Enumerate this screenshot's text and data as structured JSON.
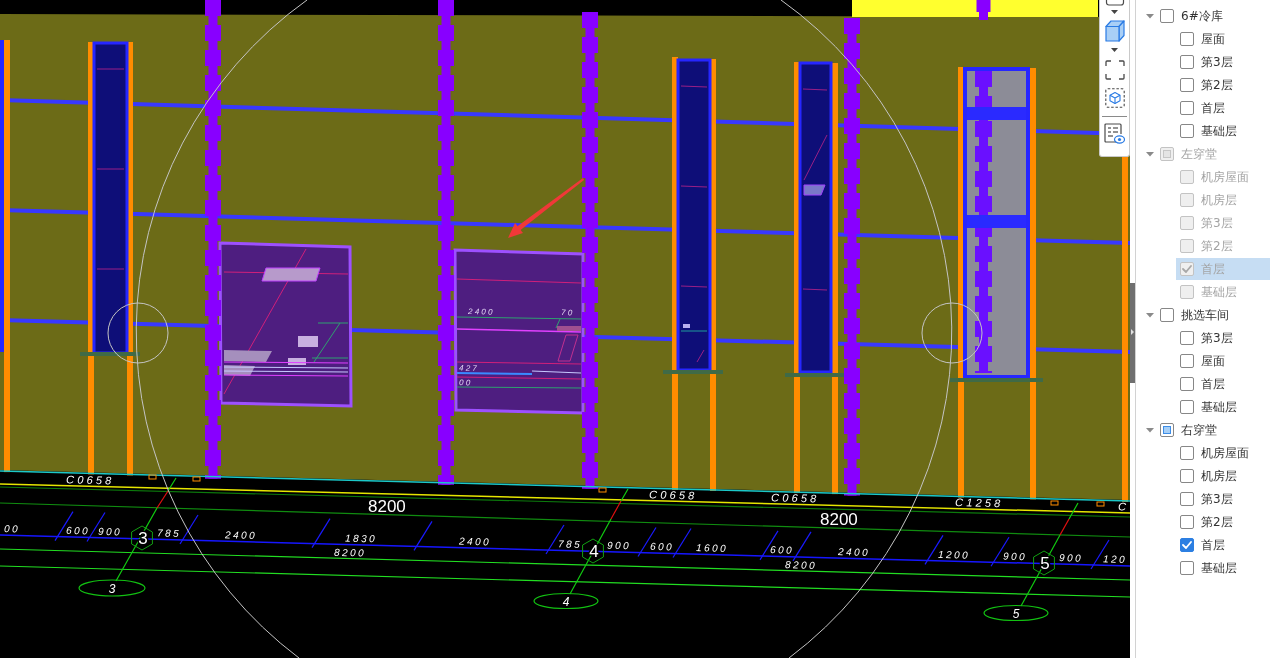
{
  "viewport": {
    "opening_tags": [
      "C0658",
      "C0658",
      "C0658",
      "C1258",
      "C"
    ],
    "bay_dimensions": [
      "8200",
      "8200"
    ],
    "segment_dimensions": [
      "00",
      "600",
      "900",
      "785",
      "2400",
      "1830",
      "2400",
      "785",
      "900",
      "600",
      "1600",
      "600",
      "2400",
      "1200",
      "900",
      "900",
      "120"
    ],
    "total_dimensions": [
      "8200",
      "8200"
    ],
    "axis_markers": [
      "3",
      "4",
      "5"
    ],
    "axis_bubbles": [
      "3",
      "4",
      "5"
    ],
    "window_annotations": [
      "2400",
      "70",
      "427",
      "00"
    ]
  },
  "tree": [
    {
      "label": "6#冷库",
      "expanded": true,
      "checked": false,
      "indeterminate": false,
      "disabled": false,
      "selected": false,
      "children": [
        {
          "label": "屋面",
          "checked": false,
          "disabled": false,
          "selected": false
        },
        {
          "label": "第3层",
          "checked": false,
          "disabled": false,
          "selected": false
        },
        {
          "label": "第2层",
          "checked": false,
          "disabled": false,
          "selected": false
        },
        {
          "label": "首层",
          "checked": false,
          "disabled": false,
          "selected": false
        },
        {
          "label": "基础层",
          "checked": false,
          "disabled": false,
          "selected": false
        }
      ]
    },
    {
      "label": "左穿堂",
      "expanded": true,
      "checked": false,
      "indeterminate": true,
      "disabled": true,
      "selected": false,
      "children": [
        {
          "label": "机房屋面",
          "checked": false,
          "disabled": true,
          "selected": false
        },
        {
          "label": "机房层",
          "checked": false,
          "disabled": true,
          "selected": false
        },
        {
          "label": "第3层",
          "checked": false,
          "disabled": true,
          "selected": false
        },
        {
          "label": "第2层",
          "checked": false,
          "disabled": true,
          "selected": false
        },
        {
          "label": "首层",
          "checked": true,
          "disabled": true,
          "selected": true
        },
        {
          "label": "基础层",
          "checked": false,
          "disabled": true,
          "selected": false
        }
      ]
    },
    {
      "label": "挑选车间",
      "expanded": true,
      "checked": false,
      "indeterminate": false,
      "disabled": false,
      "selected": false,
      "children": [
        {
          "label": "第3层",
          "checked": false,
          "disabled": false,
          "selected": false
        },
        {
          "label": "屋面",
          "checked": false,
          "disabled": false,
          "selected": false
        },
        {
          "label": "首层",
          "checked": false,
          "disabled": false,
          "selected": false
        },
        {
          "label": "基础层",
          "checked": false,
          "disabled": false,
          "selected": false
        }
      ]
    },
    {
      "label": "右穿堂",
      "expanded": true,
      "checked": false,
      "indeterminate": true,
      "disabled": false,
      "selected": false,
      "children": [
        {
          "label": "机房屋面",
          "checked": false,
          "disabled": false,
          "selected": false
        },
        {
          "label": "机房层",
          "checked": false,
          "disabled": false,
          "selected": false
        },
        {
          "label": "第3层",
          "checked": false,
          "disabled": false,
          "selected": false
        },
        {
          "label": "第2层",
          "checked": false,
          "disabled": false,
          "selected": false
        },
        {
          "label": "首层",
          "checked": true,
          "disabled": false,
          "selected": false
        },
        {
          "label": "基础层",
          "checked": false,
          "disabled": false,
          "selected": false
        }
      ]
    }
  ]
}
